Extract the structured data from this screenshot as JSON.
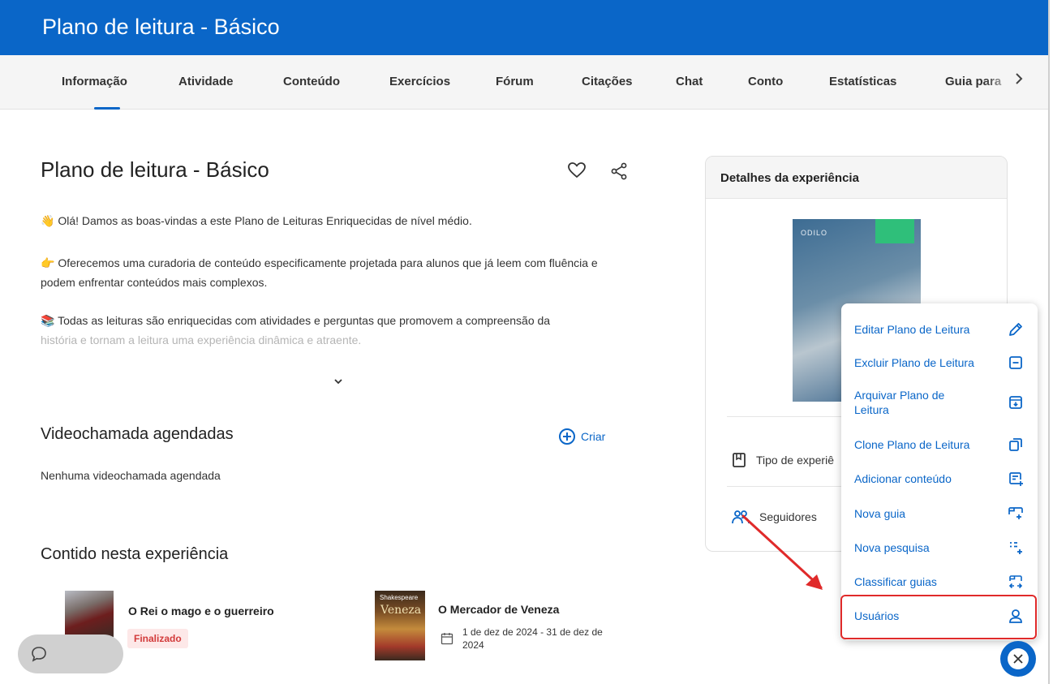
{
  "header": {
    "title": "Plano de leitura - Básico"
  },
  "tabs": [
    {
      "label": "Informação",
      "active": true
    },
    {
      "label": "Atividade"
    },
    {
      "label": "Conteúdo"
    },
    {
      "label": "Exercícios"
    },
    {
      "label": "Fórum"
    },
    {
      "label": "Citações"
    },
    {
      "label": "Chat"
    },
    {
      "label": "Conto"
    },
    {
      "label": "Estatísticas"
    },
    {
      "label": "Guia para"
    }
  ],
  "main": {
    "title": "Plano de leitura - Básico",
    "paragraphs": [
      "👋 Olá! Damos as boas-vindas a este Plano de Leituras Enriquecidas de nível médio.",
      "👉 Oferecemos uma curadoria de conteúdo especificamente projetada para alunos que já leem com fluência e podem enfrentar conteúdos mais complexos.",
      "📚 Todas as leituras são enriquecidas com atividades e perguntas que promovem a compreensão da",
      "história e tornam a leitura uma experiência dinâmica e atraente."
    ]
  },
  "videocalls": {
    "heading": "Videochamada agendadas",
    "create_label": "Criar",
    "empty_text": "Nenhuma videochamada agendada"
  },
  "contents": {
    "heading": "Contido nesta experiência",
    "items": [
      {
        "title": "O Rei o mago e o guerreiro",
        "badge": "Finalizado"
      },
      {
        "title": "O Mercador de Veneza",
        "dates": "1 de dez de 2024 - 31 de dez de 2024",
        "cover_author": "Shakespeare",
        "cover_title": "Veneza"
      }
    ]
  },
  "details": {
    "heading": "Detalhes da experiência",
    "cover_logo": "ODILO",
    "type_label": "Tipo de experiê",
    "followers_label": "Seguidores"
  },
  "menu": {
    "items": [
      {
        "label": "Editar Plano de Leitura",
        "icon": "pencil-icon"
      },
      {
        "label": "Excluir Plano de Leitura",
        "icon": "minus-box-icon"
      },
      {
        "label": "Arquivar Plano de Leitura",
        "icon": "archive-icon"
      },
      {
        "label": "Clone Plano de Leitura",
        "icon": "copy-icon"
      },
      {
        "label": "Adicionar conteúdo",
        "icon": "add-content-icon"
      },
      {
        "label": "Nova guia",
        "icon": "new-tab-icon"
      },
      {
        "label": "Nova pesquisa",
        "icon": "new-survey-icon"
      },
      {
        "label": "Classificar guias",
        "icon": "sort-tabs-icon"
      },
      {
        "label": "Usuários",
        "icon": "user-icon",
        "highlighted": true
      }
    ]
  },
  "colors": {
    "primary": "#0a66c8",
    "highlight": "#e02a2a",
    "badge_bg": "#fde8e8",
    "badge_text": "#d23a3a"
  }
}
